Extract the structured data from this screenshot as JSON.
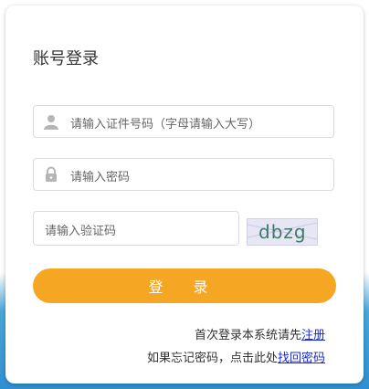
{
  "login": {
    "title": "账号登录",
    "id_placeholder": "请输入证件号码（字母请输入大写）",
    "password_placeholder": "请输入密码",
    "captcha_placeholder": "请输入验证码",
    "captcha_text": "dbzg",
    "login_button": "登 录",
    "register_hint_prefix": "首次登录本系统请先",
    "register_link": "注册",
    "forgot_hint_prefix": "如果忘记密码，点击此处",
    "forgot_link": "找回密码"
  },
  "colors": {
    "accent": "#f5a623",
    "link": "#1a2bd8",
    "captcha_text": "#3d7a6a"
  }
}
